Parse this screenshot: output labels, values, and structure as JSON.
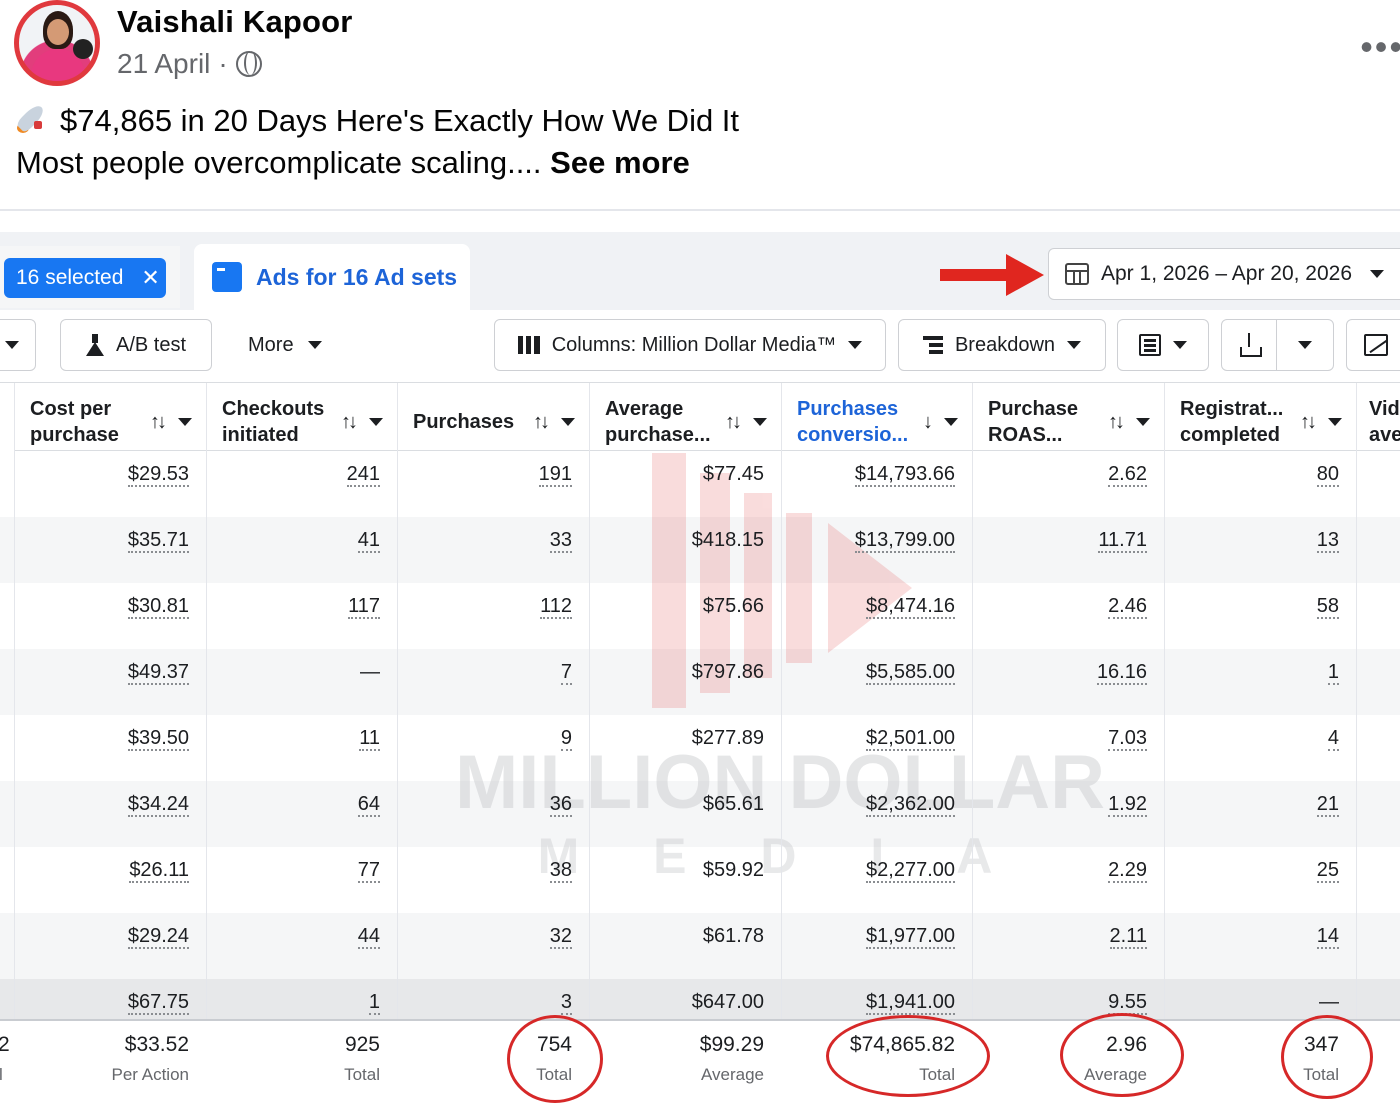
{
  "post": {
    "author": "Vaishali Kapoor",
    "date": "21 April",
    "separator": "·",
    "line1": "$74,865 in 20 Days Here's Exactly How We Did It",
    "line2": "Most people overcomplicate scaling....",
    "see_more": "See more",
    "more_icon": "•••"
  },
  "ads": {
    "selected_label": "16 selected",
    "selected_clear": "✕",
    "tab_label": "Ads for 16 Ad sets",
    "date_range": "Apr 1, 2026 – Apr 20, 2026",
    "toolbar": {
      "ab_test": "A/B test",
      "more": "More",
      "columns": "Columns: Million Dollar Media™",
      "breakdown": "Breakdown"
    },
    "columns": [
      {
        "label": "Cost per\npurchase",
        "sort": "↑↓"
      },
      {
        "label": "Checkouts\ninitiated",
        "sort": "↑↓"
      },
      {
        "label": "Purchases",
        "sort": "↑↓"
      },
      {
        "label": "Average\npurchase...",
        "sort": "↑↓"
      },
      {
        "label": "Purchases\nconversio...",
        "sort": "↓"
      },
      {
        "label": "Purchase\nROAS...",
        "sort": "↑↓"
      },
      {
        "label": "Registrat...\ncompleted",
        "sort": "↑↓"
      },
      {
        "label": "Vid\nave",
        "sort": ""
      }
    ],
    "rows": [
      [
        "$29.53",
        "241",
        "191",
        "$77.45",
        "$14,793.66",
        "2.62",
        "80"
      ],
      [
        "$35.71",
        "41",
        "33",
        "$418.15",
        "$13,799.00",
        "11.71",
        "13"
      ],
      [
        "$30.81",
        "117",
        "112",
        "$75.66",
        "$8,474.16",
        "2.46",
        "58"
      ],
      [
        "$49.37",
        "—",
        "7",
        "$797.86",
        "$5,585.00",
        "16.16",
        "1"
      ],
      [
        "$39.50",
        "11",
        "9",
        "$277.89",
        "$2,501.00",
        "7.03",
        "4"
      ],
      [
        "$34.24",
        "64",
        "36",
        "$65.61",
        "$2,362.00",
        "1.92",
        "21"
      ],
      [
        "$26.11",
        "77",
        "38",
        "$59.92",
        "$2,277.00",
        "2.29",
        "25"
      ],
      [
        "$29.24",
        "44",
        "32",
        "$61.78",
        "$1,977.00",
        "2.11",
        "14"
      ],
      [
        "$67.75",
        "1",
        "3",
        "$647.00",
        "$1,941.00",
        "9.55",
        "—"
      ]
    ],
    "totals": [
      {
        "value": "$33.52",
        "label": "Per Action"
      },
      {
        "value": "925",
        "label": "Total"
      },
      {
        "value": "754",
        "label": "Total"
      },
      {
        "value": "$99.29",
        "label": "Average"
      },
      {
        "value": "$74,865.82",
        "label": "Total"
      },
      {
        "value": "2.96",
        "label": "Average"
      },
      {
        "value": "347",
        "label": "Total"
      }
    ],
    "edge_total_fragment": [
      "2",
      "l"
    ]
  },
  "watermark": {
    "line1": "MILLION DOLLAR",
    "line2": "M E D I A"
  },
  "colors": {
    "accent_blue": "#1877f2",
    "annotation_red": "#d62828",
    "avatar_ring": "#e0393e"
  },
  "icons": {
    "globe": "globe-icon",
    "calendar": "calendar-icon",
    "flask": "flask-icon",
    "columns": "columns-icon",
    "breakdown": "breakdown-icon",
    "reports": "reports-icon",
    "export": "export-icon",
    "chart": "chart-icon"
  }
}
